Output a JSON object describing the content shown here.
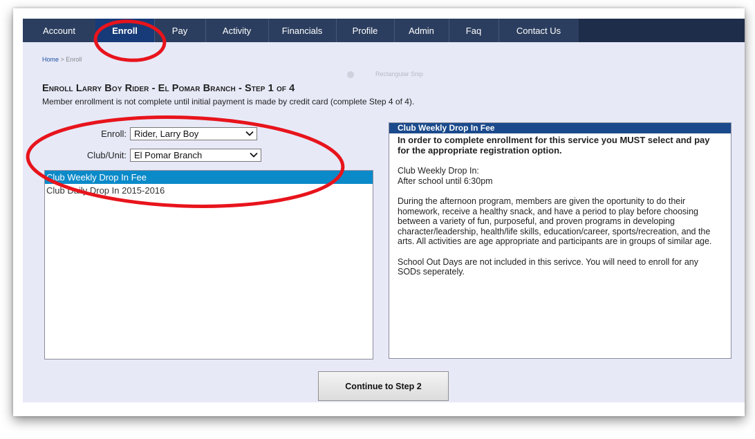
{
  "nav": {
    "tabs": [
      {
        "label": "Account"
      },
      {
        "label": "Enroll"
      },
      {
        "label": "Pay"
      },
      {
        "label": "Activity"
      },
      {
        "label": "Financials"
      },
      {
        "label": "Profile"
      },
      {
        "label": "Admin"
      },
      {
        "label": "Faq"
      },
      {
        "label": "Contact Us"
      }
    ],
    "active_tab": "Enroll"
  },
  "breadcrumb": {
    "home": "Home",
    "separator": " > ",
    "current": "Enroll"
  },
  "overlay": {
    "snip_label": "Rectangular Snip"
  },
  "page_title": "Enroll Larry Boy Rider - El Pomar Branch - Step 1 of 4",
  "subtitle": "Member enrollment is not complete until initial payment is made by credit card (complete Step 4 of 4).",
  "form": {
    "enroll_label": "Enroll:",
    "enroll_value": "Rider, Larry Boy",
    "club_label": "Club/Unit:",
    "club_value": "El Pomar Branch"
  },
  "services": {
    "items": [
      {
        "label": "Club Weekly Drop In Fee"
      },
      {
        "label": "Club Daily Drop In 2015-2016"
      }
    ],
    "selected_index": 0
  },
  "detail": {
    "header": "Club Weekly Drop In Fee",
    "notice": "In order to complete enrollment for this service you MUST select and pay for the appropriate registration option.",
    "line1": "Club Weekly Drop In:",
    "line2": "After school until 6:30pm",
    "paragraph1": "During the afternoon program, members are given the oportunity to do their homework, receive a healthy snack, and have a period to play before choosing between a variety of fun, purposeful, and proven programs in developing character/leadership, health/life skills, education/career, sports/recreation, and the arts. All activities are age appropriate and participants are in groups of similar age.",
    "paragraph2": "School Out Days are not included in this serivce. You will need to enroll for any SODs seperately."
  },
  "buttons": {
    "continue": "Continue to Step 2"
  },
  "colors": {
    "navbar": "#2c3e5f",
    "active_tab": "#173a78",
    "page_bg": "#e7e9f7",
    "list_selected": "#0b8ac9",
    "detail_header": "#1b4a8c",
    "annotation": "#e8141c"
  }
}
